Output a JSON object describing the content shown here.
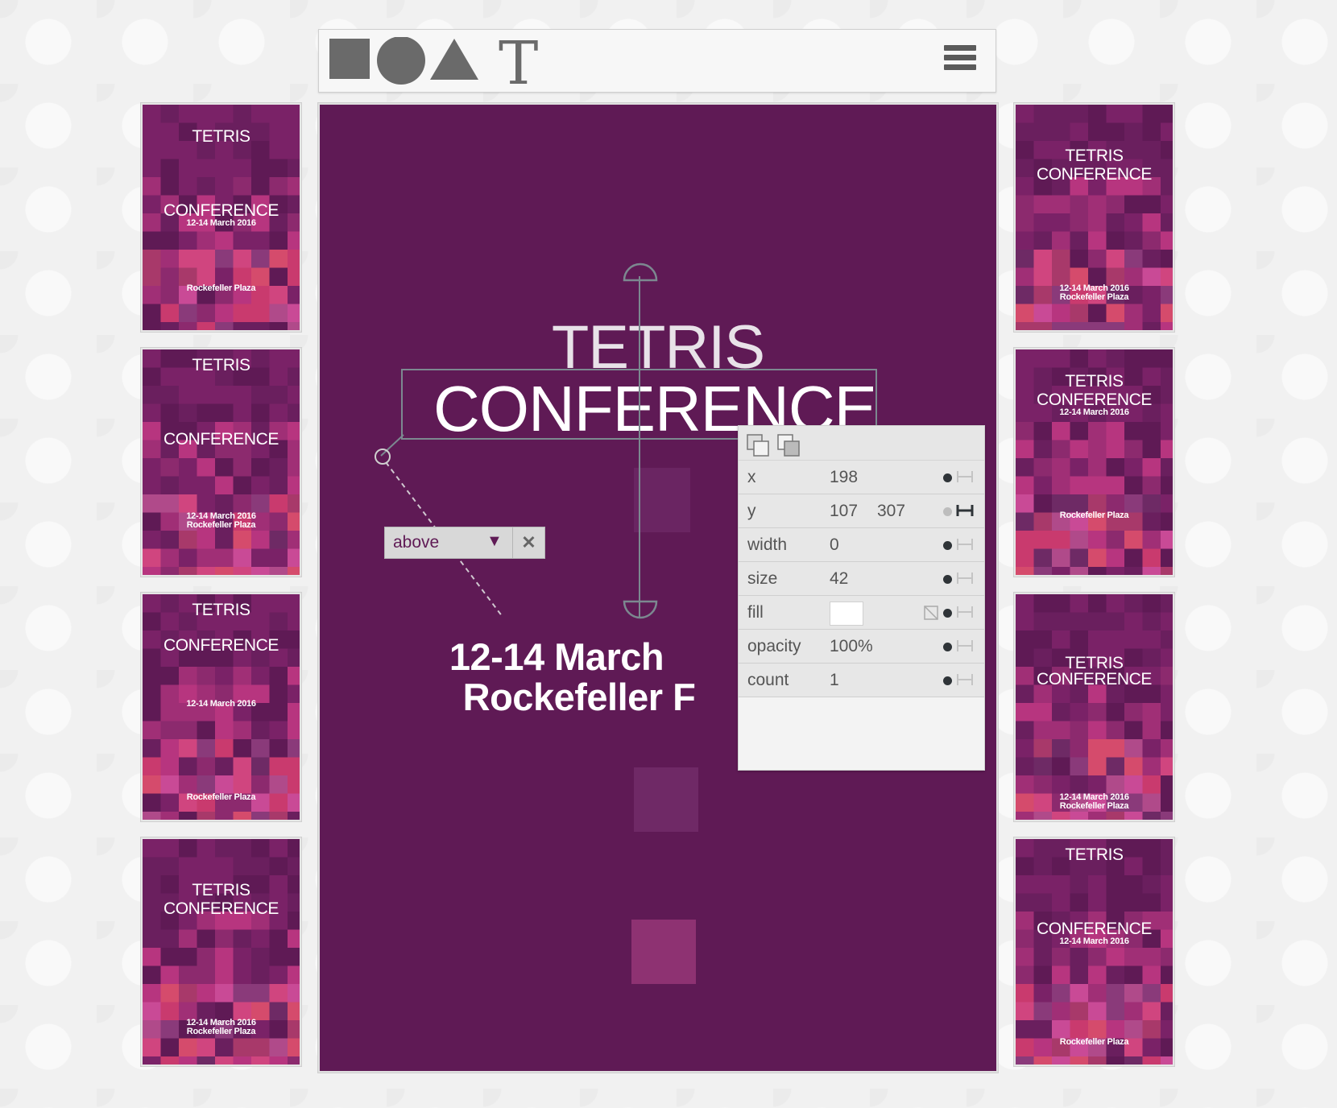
{
  "app": {
    "logo_letter": "T",
    "menu_icon": "hamburger-menu-icon"
  },
  "colors": {
    "poster_bg": "#5f1a55",
    "guide": "#7c8890",
    "panel": "#e7e7e7"
  },
  "thumbnails_left": [
    {
      "lines": [
        "TETRIS",
        "CONFERENCE",
        "12-14 March 2016",
        "Rockefeller Plaza"
      ]
    },
    {
      "lines": [
        "TETRIS",
        "CONFERENCE",
        "12-14 March 2016",
        "Rockefeller Plaza"
      ]
    },
    {
      "lines": [
        "TETRIS",
        "CONFERENCE",
        "12-14 March 2016",
        "Rockefeller Plaza"
      ]
    },
    {
      "lines": [
        "TETRIS",
        "CONFERENCE",
        "12-14 March 2016",
        "Rockefeller Plaza"
      ]
    }
  ],
  "thumbnails_right": [
    {
      "lines": [
        "TETRIS",
        "CONFERENCE",
        "12-14 March 2016",
        "Rockefeller Plaza"
      ]
    },
    {
      "lines": [
        "TETRIS",
        "CONFERENCE",
        "12-14 March 2016",
        "Rockefeller Plaza"
      ]
    },
    {
      "lines": [
        "TETRIS",
        "CONFERENCE",
        "12-14 March 2016",
        "Rockefeller Plaza"
      ]
    },
    {
      "lines": [
        "TETRIS",
        "CONFERENCE",
        "12-14 March 2016",
        "Rockefeller Plaza"
      ]
    }
  ],
  "poster": {
    "title_line1": "TETRIS",
    "title_line2": "CONFERENCE",
    "date_line": "12-14 March",
    "place_line": "Rockefeller F"
  },
  "dropdown": {
    "value": "above",
    "arrow": "▼",
    "close": "✕"
  },
  "panel": {
    "x_label": "x",
    "x_value": "198",
    "y_label": "y",
    "y_value": "107",
    "y_value2": "307",
    "width_label": "width",
    "width_value": "0",
    "size_label": "size",
    "size_value": "42",
    "fill_label": "fill",
    "fill_value": "#ffffff",
    "opacity_label": "opacity",
    "opacity_value": "100%",
    "count_label": "count",
    "count_value": "1"
  }
}
